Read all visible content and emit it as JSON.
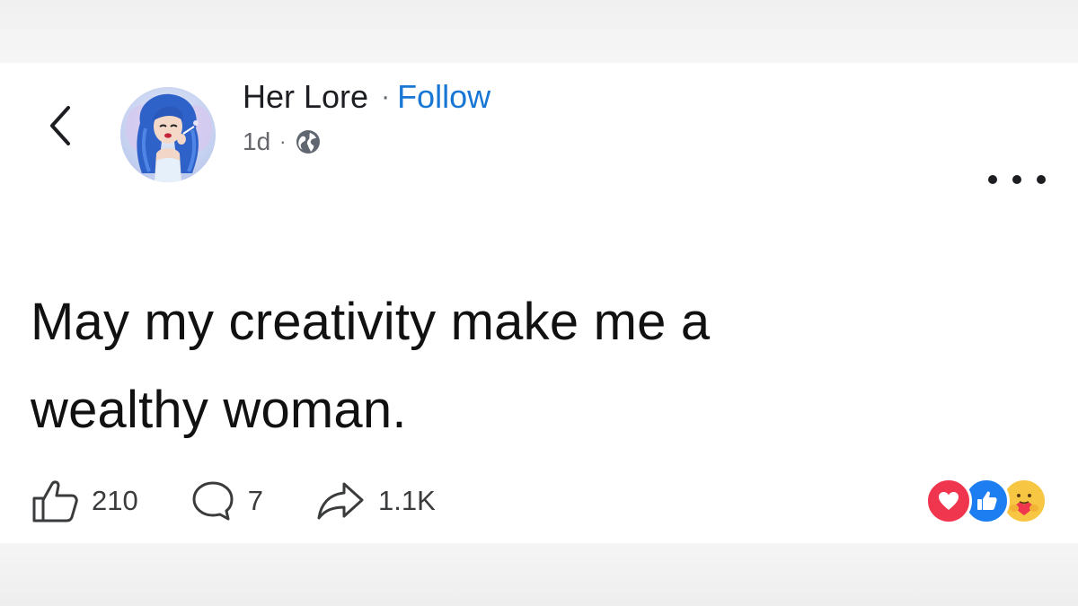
{
  "post": {
    "author": "Her Lore",
    "separator": "·",
    "follow_label": "Follow",
    "timestamp": "1d",
    "meta_separator": "·",
    "privacy_icon": "globe-icon",
    "text_line1": "May my creativity make me a",
    "text_line2": "wealthy woman."
  },
  "nav": {
    "back_icon": "chevron-left-icon",
    "more_icon": "more-options-icon"
  },
  "engagement": {
    "likes": "210",
    "comments": "7",
    "shares": "1.1K",
    "reactions": [
      "love",
      "like",
      "care"
    ]
  },
  "colors": {
    "follow": "#1877d4",
    "love": "#f0364e",
    "like": "#1d7ef2",
    "care": "#f7c744"
  }
}
